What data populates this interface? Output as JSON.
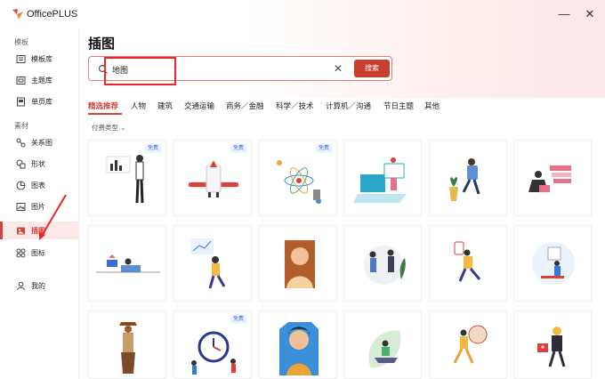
{
  "app": {
    "name": "OfficePLUS"
  },
  "window": {
    "minimize_symbol": "—",
    "close_symbol": "✕"
  },
  "sidebar": {
    "template_section": "模板",
    "material_section": "素材",
    "items": [
      {
        "label": "模板库",
        "icon": "template-library-icon"
      },
      {
        "label": "主题库",
        "icon": "theme-library-icon"
      },
      {
        "label": "单页库",
        "icon": "single-page-icon"
      },
      {
        "label": "关系图",
        "icon": "relationship-chart-icon"
      },
      {
        "label": "形状",
        "icon": "shapes-icon"
      },
      {
        "label": "图表",
        "icon": "chart-icon"
      },
      {
        "label": "图片",
        "icon": "image-icon"
      },
      {
        "label": "插图",
        "icon": "illustration-icon",
        "active": true
      },
      {
        "label": "图标",
        "icon": "icon-library-icon"
      },
      {
        "label": "我的",
        "icon": "user-icon"
      }
    ]
  },
  "main": {
    "title": "插图",
    "search": {
      "value": "地图",
      "button_label": "搜索"
    },
    "tabs": [
      {
        "label": "精选推荐",
        "active": true
      },
      {
        "label": "人物"
      },
      {
        "label": "建筑"
      },
      {
        "label": "交通运输"
      },
      {
        "label": "商务／金融"
      },
      {
        "label": "科学／技术"
      },
      {
        "label": "计算机／沟通"
      },
      {
        "label": "节日主题"
      },
      {
        "label": "其他"
      }
    ],
    "filter_label": "付费类型",
    "filter_chevron": "⌄",
    "free_badge": "免费",
    "cards": [
      {
        "subject": "business-man-presenting-chart",
        "free": true
      },
      {
        "subject": "airplane",
        "free": true
      },
      {
        "subject": "science-atom-molecules",
        "free": true
      },
      {
        "subject": "computer-screens-workers",
        "free": false
      },
      {
        "subject": "man-on-chair-with-plant",
        "free": false
      },
      {
        "subject": "woman-laptop-documents",
        "free": false
      },
      {
        "subject": "man-lying-with-laptop",
        "free": false
      },
      {
        "subject": "person-holding-chart",
        "free": false
      },
      {
        "subject": "man-portrait",
        "free": false
      },
      {
        "subject": "handshake-people",
        "free": false
      },
      {
        "subject": "person-running-with-phone",
        "free": false
      },
      {
        "subject": "person-at-desk-board",
        "free": false
      },
      {
        "subject": "woman-holding-coffee",
        "free": false
      },
      {
        "subject": "clock-with-people",
        "free": true
      },
      {
        "subject": "man-with-beard-portrait",
        "free": false
      },
      {
        "subject": "woman-meditating-laptop",
        "free": false
      },
      {
        "subject": "dancer-with-drum",
        "free": false
      },
      {
        "subject": "firefighter-with-box",
        "free": false
      }
    ]
  },
  "colors": {
    "accent": "#d0453a",
    "highlight_box": "#e8262b",
    "badge_text": "#3478e0"
  }
}
